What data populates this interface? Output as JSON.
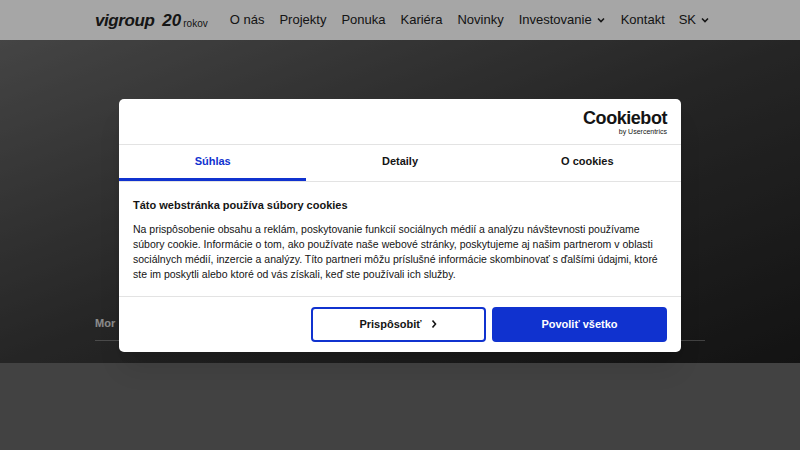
{
  "nav": {
    "logo": "vigroup",
    "logo_badge": "20",
    "logo_badge_sub": "rokov",
    "items": [
      {
        "label": "O nás",
        "has_dropdown": false
      },
      {
        "label": "Projekty",
        "has_dropdown": false
      },
      {
        "label": "Ponuka",
        "has_dropdown": false
      },
      {
        "label": "Kariéra",
        "has_dropdown": false
      },
      {
        "label": "Novinky",
        "has_dropdown": false
      },
      {
        "label": "Investovanie",
        "has_dropdown": true
      },
      {
        "label": "Kontakt",
        "has_dropdown": false
      }
    ],
    "language": "SK"
  },
  "hero": {
    "breadcrumb": "Mor"
  },
  "dialog": {
    "brand": "Cookiebot",
    "brand_sub": "by Usercentrics",
    "tabs": [
      {
        "label": "Súhlas",
        "selected": true
      },
      {
        "label": "Detaily",
        "selected": false
      },
      {
        "label": "O cookies",
        "selected": false
      }
    ],
    "heading": "Táto webstránka používa súbory cookies",
    "body": "Na prispôsobenie obsahu a reklám, poskytovanie funkcií sociálnych médií a analýzu návštevnosti používame súbory cookie. Informácie o tom, ako používate naše webové stránky, poskytujeme aj našim partnerom v oblasti sociálnych médií, inzercie a analýzy. Títo partneri môžu príslušné informácie skombinovať s ďalšími údajmi, ktoré ste im poskytli alebo ktoré od vás získali, keď ste používali ich služby.",
    "buttons": [
      {
        "label": "Prispôsobiť",
        "kind": "outline"
      },
      {
        "label": "Povoliť všetko",
        "kind": "primary"
      }
    ]
  }
}
